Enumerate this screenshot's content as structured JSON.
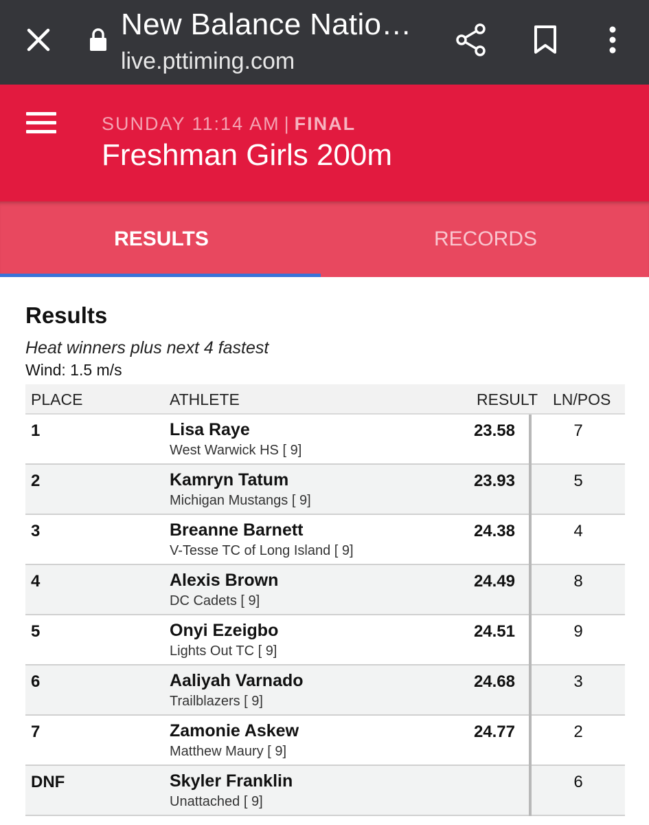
{
  "browser": {
    "title": "New Balance Natio…",
    "url": "live.pttiming.com",
    "icons": [
      "close-icon",
      "lock-icon",
      "share-icon",
      "bookmark-icon",
      "more-vert-icon"
    ]
  },
  "event": {
    "day_time": "SUNDAY 11:14 AM",
    "separator": "|",
    "status": "FINAL",
    "title": "Freshman Girls 200m",
    "brand_color": "#e21a3f"
  },
  "tabs": [
    {
      "label": "RESULTS",
      "active": true
    },
    {
      "label": "RECORDS",
      "active": false
    }
  ],
  "results": {
    "title": "Results",
    "note": "Heat winners plus next 4 fastest",
    "wind": "Wind: 1.5 m/s",
    "columns": {
      "place": "PLACE",
      "athlete": "ATHLETE",
      "result": "RESULT",
      "lnpos": "LN/POS"
    },
    "rows": [
      {
        "place": "1",
        "name": "Lisa Raye",
        "team": "West Warwick HS [ 9]",
        "result": "23.58",
        "lnpos": "7"
      },
      {
        "place": "2",
        "name": "Kamryn Tatum",
        "team": "Michigan Mustangs [ 9]",
        "result": "23.93",
        "lnpos": "5"
      },
      {
        "place": "3",
        "name": "Breanne Barnett",
        "team": "V-Tesse TC of Long Island [ 9]",
        "result": "24.38",
        "lnpos": "4"
      },
      {
        "place": "4",
        "name": "Alexis Brown",
        "team": "DC Cadets [ 9]",
        "result": "24.49",
        "lnpos": "8"
      },
      {
        "place": "5",
        "name": "Onyi Ezeigbo",
        "team": "Lights Out TC [ 9]",
        "result": "24.51",
        "lnpos": "9"
      },
      {
        "place": "6",
        "name": "Aaliyah Varnado",
        "team": "Trailblazers [ 9]",
        "result": "24.68",
        "lnpos": "3"
      },
      {
        "place": "7",
        "name": "Zamonie Askew",
        "team": "Matthew Maury [ 9]",
        "result": "24.77",
        "lnpos": "2"
      },
      {
        "place": "DNF",
        "name": "Skyler Franklin",
        "team": "Unattached [ 9]",
        "result": "",
        "lnpos": "6"
      }
    ]
  }
}
